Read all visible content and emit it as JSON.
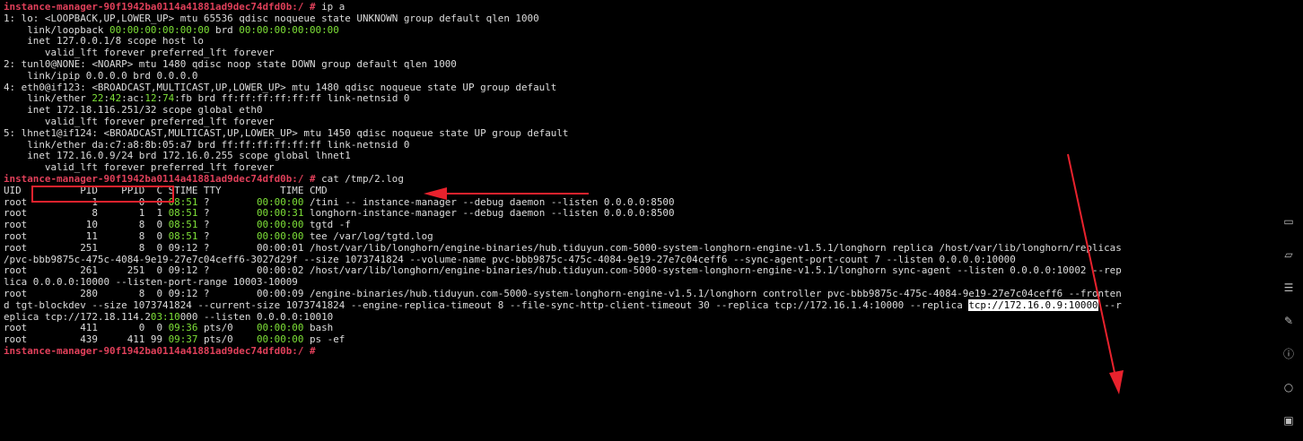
{
  "colors": {
    "background": "#000000",
    "text": "#dcdcdc",
    "prompt": "#e0405a",
    "green": "#7ee038",
    "annotation": "#e8222d",
    "highlight_bg": "#ffffff"
  },
  "terminal": {
    "lines": [
      [
        {
          "t": "instance-manager-90f1942ba0114a41881ad9dec74dfd0b:/ # ",
          "c": "prompt"
        },
        {
          "t": "ip a",
          "c": "plain"
        }
      ],
      [
        {
          "t": "1: lo: <LOOPBACK,UP,LOWER_UP> mtu 65536 qdisc noqueue state UNKNOWN group default qlen 1000",
          "c": "plain"
        }
      ],
      [
        {
          "t": "    link/loopback ",
          "c": "plain"
        },
        {
          "t": "00:00:00:00:00:00",
          "c": "green"
        },
        {
          "t": " brd ",
          "c": "plain"
        },
        {
          "t": "00:00:00:00:00:00",
          "c": "green"
        }
      ],
      [
        {
          "t": "    inet 127.0.0.1/8 scope host lo",
          "c": "plain"
        }
      ],
      [
        {
          "t": "       valid_lft forever preferred_lft forever",
          "c": "plain"
        }
      ],
      [
        {
          "t": "2: tunl0@NONE: <NOARP> mtu 1480 qdisc noop state DOWN group default qlen 1000",
          "c": "plain"
        }
      ],
      [
        {
          "t": "    link/ipip 0.0.0.0 brd 0.0.0.0",
          "c": "plain"
        }
      ],
      [
        {
          "t": "4: eth0@if123: <BROADCAST,MULTICAST,UP,LOWER_UP> mtu 1480 qdisc noqueue state UP group default",
          "c": "plain"
        }
      ],
      [
        {
          "t": "    link/ether ",
          "c": "plain"
        },
        {
          "t": "22",
          "c": "green"
        },
        {
          "t": ":",
          "c": "plain"
        },
        {
          "t": "42",
          "c": "green"
        },
        {
          "t": ":ac:",
          "c": "plain"
        },
        {
          "t": "12",
          "c": "green"
        },
        {
          "t": ":",
          "c": "plain"
        },
        {
          "t": "74",
          "c": "green"
        },
        {
          "t": ":fb brd ff:ff:ff:ff:ff:ff link-netnsid 0",
          "c": "plain"
        }
      ],
      [
        {
          "t": "    inet 172.18.116.251/32 scope global eth0",
          "c": "plain"
        }
      ],
      [
        {
          "t": "       valid_lft forever preferred_lft forever",
          "c": "plain"
        }
      ],
      [
        {
          "t": "5: lhnet1@if124: <BROADCAST,MULTICAST,UP,LOWER_UP> mtu 1450 qdisc noqueue state UP group default",
          "c": "plain"
        }
      ],
      [
        {
          "t": "    link/ether da:c7:a8:8b:05:a7 brd ff:ff:ff:ff:ff:ff link-netnsid 0",
          "c": "plain"
        }
      ],
      [
        {
          "t": "    inet 172.16.0.9/24 brd 172.16.0.255 scope global lhnet1",
          "c": "plain"
        }
      ],
      [
        {
          "t": "       valid_lft forever preferred_lft forever",
          "c": "plain"
        }
      ],
      [
        {
          "t": "instance-manager-90f1942ba0114a41881ad9dec74dfd0b:/ # ",
          "c": "prompt"
        },
        {
          "t": "cat /tmp/2.log",
          "c": "plain"
        }
      ],
      [
        {
          "t": "UID          PID    PPID  C STIME TTY          TIME CMD",
          "c": "plain"
        }
      ],
      [
        {
          "t": "root           1       0  0 ",
          "c": "plain"
        },
        {
          "t": "08:51",
          "c": "green"
        },
        {
          "t": " ?        ",
          "c": "plain"
        },
        {
          "t": "00:00:00",
          "c": "green"
        },
        {
          "t": " /tini -- instance-manager --debug daemon --listen 0.0.0.0:8500",
          "c": "plain"
        }
      ],
      [
        {
          "t": "root           8       1  1 ",
          "c": "plain"
        },
        {
          "t": "08:51",
          "c": "green"
        },
        {
          "t": " ?        ",
          "c": "plain"
        },
        {
          "t": "00:00:31",
          "c": "green"
        },
        {
          "t": " longhorn-instance-manager --debug daemon --listen 0.0.0.0:8500",
          "c": "plain"
        }
      ],
      [
        {
          "t": "root          10       8  0 ",
          "c": "plain"
        },
        {
          "t": "08:51",
          "c": "green"
        },
        {
          "t": " ?        ",
          "c": "plain"
        },
        {
          "t": "00:00:00",
          "c": "green"
        },
        {
          "t": " tgtd -f",
          "c": "plain"
        }
      ],
      [
        {
          "t": "root          11       8  0 ",
          "c": "plain"
        },
        {
          "t": "08:51",
          "c": "green"
        },
        {
          "t": " ?        ",
          "c": "plain"
        },
        {
          "t": "00:00:00",
          "c": "green"
        },
        {
          "t": " tee /var/log/tgtd.log",
          "c": "plain"
        }
      ],
      [
        {
          "t": "root         251       8  0 09:12 ?        00:00:01 /host/var/lib/longhorn/engine-binaries/hub.tiduyun.com-5000-system-longhorn-engine-v1.5.1/longhorn replica /host/var/lib/longhorn/replicas",
          "c": "plain"
        }
      ],
      [
        {
          "t": "/pvc-bbb9875c-475c-4084-9e19-27e7c04ceff6-3027d29f --size 1073741824 --volume-name pvc-bbb9875c-475c-4084-9e19-27e7c04ceff6 --sync-agent-port-count 7 --listen 0.0.0.0:10000",
          "c": "plain"
        }
      ],
      [
        {
          "t": "root         261     251  0 09:12 ?        00:00:02 /host/var/lib/longhorn/engine-binaries/hub.tiduyun.com-5000-system-longhorn-engine-v1.5.1/longhorn sync-agent --listen 0.0.0.0:10002 --rep",
          "c": "plain"
        }
      ],
      [
        {
          "t": "lica 0.0.0.0:10000 --listen-port-range 10003-10009",
          "c": "plain"
        }
      ],
      [
        {
          "t": "root         280       8  0 09:12 ?        00:00:09 /engine-binaries/hub.tiduyun.com-5000-system-longhorn-engine-v1.5.1/longhorn controller pvc-bbb9875c-475c-4084-9e19-27e7c04ceff6 --fronten",
          "c": "plain"
        }
      ],
      [
        {
          "t": "d tgt-blockdev --size 1073741824 --current-size 1073741824 --engine-replica-timeout 8 --file-sync-http-client-timeout 30 --replica tcp://172.16.1.4:10000 --replica ",
          "c": "plain"
        },
        {
          "t": "tcp://172.16.0.9:10000",
          "c": "hl"
        },
        {
          "t": " --r",
          "c": "plain"
        }
      ],
      [
        {
          "t": "eplica tcp://172.18.114.2",
          "c": "plain"
        },
        {
          "t": "03:10",
          "c": "green"
        },
        {
          "t": "000 --listen 0.0.0.0:10010",
          "c": "plain"
        }
      ],
      [
        {
          "t": "root         411       0  0 ",
          "c": "plain"
        },
        {
          "t": "09:36",
          "c": "green"
        },
        {
          "t": " pts/0    ",
          "c": "plain"
        },
        {
          "t": "00:00:00",
          "c": "green"
        },
        {
          "t": " bash",
          "c": "plain"
        }
      ],
      [
        {
          "t": "root         439     411 99 ",
          "c": "plain"
        },
        {
          "t": "09:37",
          "c": "green"
        },
        {
          "t": " pts/0    ",
          "c": "plain"
        },
        {
          "t": "00:00:00",
          "c": "green"
        },
        {
          "t": " ps -ef",
          "c": "plain"
        }
      ],
      [
        {
          "t": "instance-manager-90f1942ba0114a41881ad9dec74dfd0b:/ # ",
          "c": "prompt"
        },
        {
          "t": "",
          "c": "plain"
        }
      ]
    ]
  },
  "sidebar": {
    "icons": [
      "terminal-icon",
      "folder-icon",
      "list-icon",
      "edit-icon",
      "info-icon",
      "search-icon",
      "image-icon"
    ]
  }
}
